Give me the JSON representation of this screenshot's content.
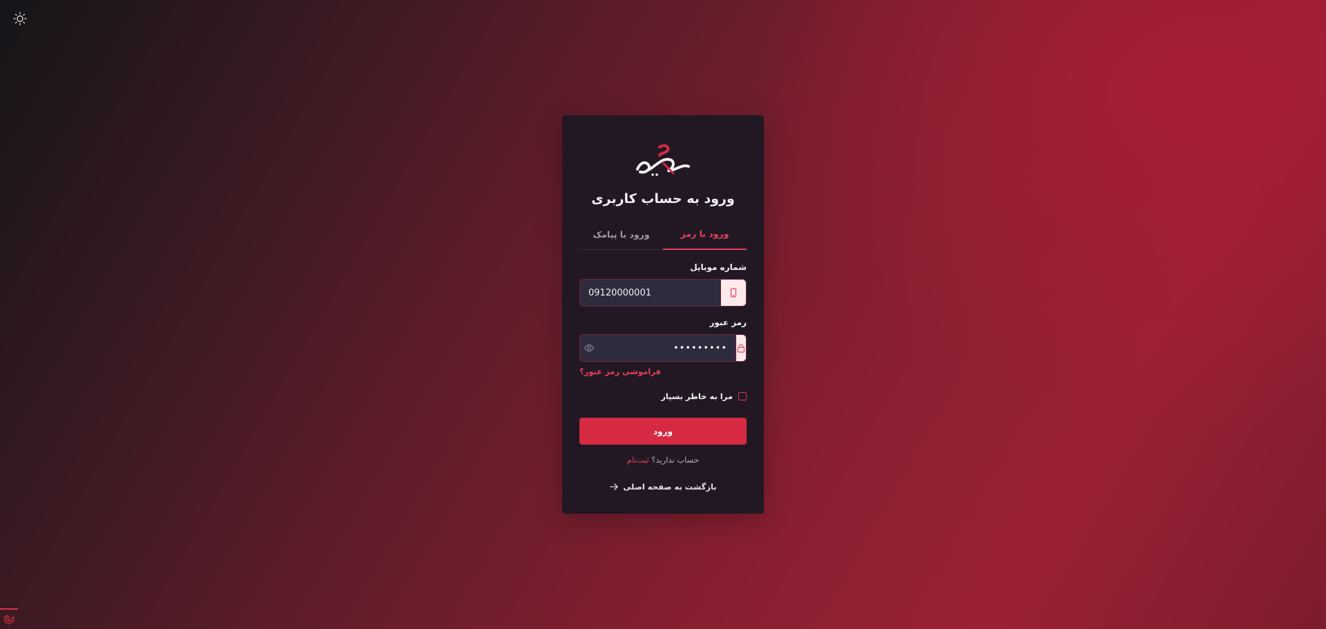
{
  "header": {
    "theme_toggle_icon": "sun-icon"
  },
  "login": {
    "logo_text": "فیکس",
    "title": "ورود به حساب کاربری",
    "tabs": [
      {
        "label": "ورود با رمز",
        "active": true
      },
      {
        "label": "ورود با پیامک",
        "active": false
      }
    ],
    "mobile": {
      "label": "شماره موبایل",
      "value": "09120000001",
      "icon": "phone-icon"
    },
    "password": {
      "label": "رمز عبور",
      "value": "•••••••••",
      "icon": "lock-icon",
      "toggle_icon": "eye-icon"
    },
    "forgot_label": "فراموشی رمز عبور؟",
    "remember_label": "مرا به خاطر بسپار",
    "remember_checked": false,
    "submit_label": "ورود",
    "no_account_text": "حساب ندارید؟",
    "signup_label": "ثبت‌نام",
    "back_label": "بازگشت به صفحه اصلی",
    "back_icon": "arrow-right-icon"
  },
  "footer": {
    "badge_icon": "laravel-icon"
  },
  "colors": {
    "accent": "#e8415b",
    "button": "#d62a43",
    "card": "#211823",
    "input": "#2e2b3d"
  }
}
